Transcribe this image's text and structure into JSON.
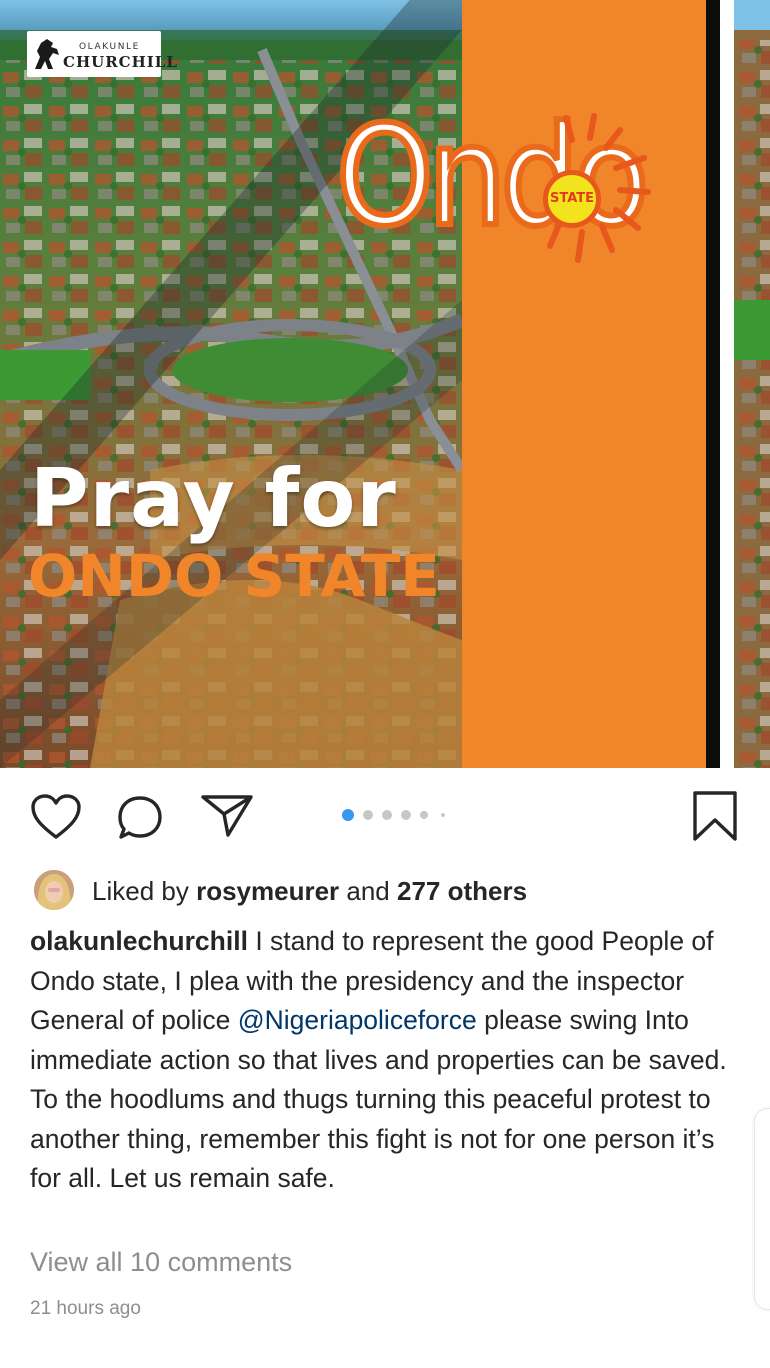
{
  "post": {
    "image": {
      "brand_small": "OLAKUNLE",
      "brand_big": "CHURCHILL",
      "headline_1": "Pray for",
      "headline_2": "ONDO STATE",
      "logo_word": "Ondo",
      "logo_badge": "STATE",
      "colors": {
        "orange_panel": "#f0852a",
        "logo_orange": "#ea6a1c",
        "sun_yellow": "#f3e31e"
      }
    },
    "actions": {
      "like_icon": "heart-icon",
      "comment_icon": "comment-bubble-icon",
      "share_icon": "paper-plane-icon",
      "save_icon": "bookmark-icon",
      "carousel_count": 6,
      "carousel_active": 1,
      "accent": "#3897f0"
    },
    "likes": {
      "prefix": "Liked by",
      "user": "rosymeurer",
      "joiner": "and",
      "others": "277 others"
    },
    "caption": {
      "username": "olakunlechurchill",
      "text_1": "I stand to represent the good People of Ondo state, I plea with the presidency and the inspector General of police",
      "mention": "@Nigeriapoliceforce",
      "text_2": "please swing Into immediate action so that lives and properties can be saved.",
      "text_3": "To the hoodlums and thugs turning this peaceful protest to another thing, remember this fight is not for one person it’s for all. Let us remain safe."
    },
    "comments_link": "View all 10 comments",
    "timestamp": "21 hours ago"
  }
}
